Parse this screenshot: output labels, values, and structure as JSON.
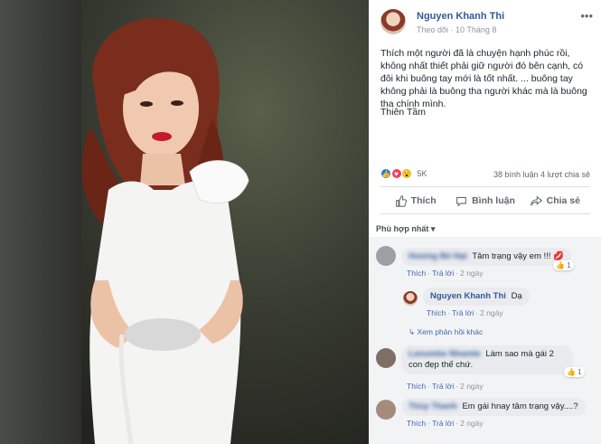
{
  "post": {
    "author": "Nguyen Khanh Thi",
    "follow": "Theo dõi",
    "date": "10 Tháng 8",
    "more": "•••",
    "caption": "Thích một người đã là chuyện hạnh phúc rồi, không nhất thiết phải giữ người đó bên cạnh, có đôi khi buông tay mới là tốt nhất. ... buông tay không phải là buông tha người khác mà là buông tha chính mình.",
    "signature": "Thiên Tầm"
  },
  "reactions": {
    "count": "5K",
    "comments": "38 bình luận",
    "shares": "4 lượt chia sẻ"
  },
  "actions": {
    "like": "Thích",
    "comment": "Bình luận",
    "share": "Chia sẻ"
  },
  "sort_label": "Phù hợp nhất ▾",
  "comments": [
    {
      "name": "Hương Bé Hạt",
      "text": "Tâm trạng vậy em !!!",
      "reply_count": "1",
      "like": "Thích",
      "reply": "Trả lời",
      "time": "2 ngày"
    },
    {
      "name": "Nguyen Khanh Thi",
      "text": "Dạ",
      "like": "Thích",
      "reply": "Trả lời",
      "time": "2 ngày",
      "view_more": "Xem phản hồi khác"
    },
    {
      "name": "Lanumbe Nhamte",
      "text": "Làm sao mà gái 2 con đẹp thế chứ.",
      "reply_count": "1",
      "like": "Thích",
      "reply": "Trả lời",
      "time": "2 ngày"
    },
    {
      "name": "Thùy Thanh",
      "text": "Em gái hnay tâm trạng vậy....?",
      "like": "Thích",
      "reply": "Trả lời",
      "time": "2 ngày"
    }
  ]
}
